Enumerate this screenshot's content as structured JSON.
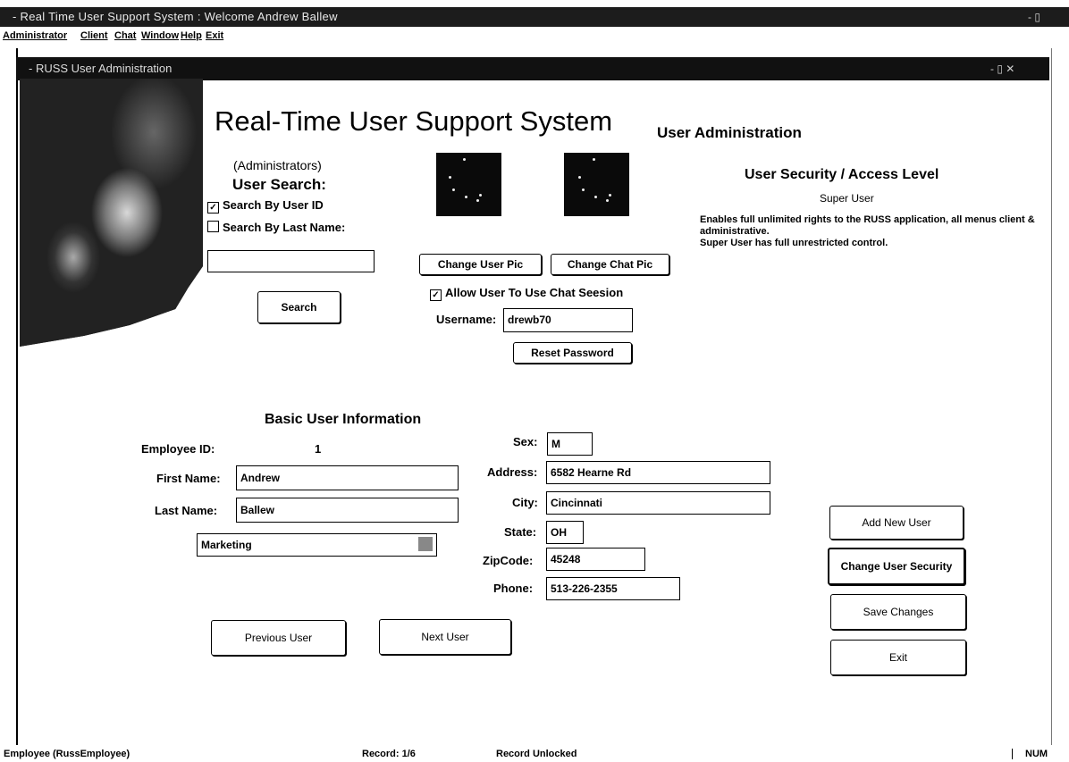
{
  "window": {
    "title": "- Real Time User Support System : Welcome Andrew Ballew",
    "controls": "- ▯"
  },
  "menu": [
    "Administrator",
    "Client",
    "Chat",
    "Window",
    "Help",
    "Exit"
  ],
  "child_window": {
    "title": "- RUSS User Administration",
    "controls": "- ▯ ✕"
  },
  "header": {
    "title": "Real-Time User Support System",
    "section": "User Administration",
    "subtitle": "(Administrators)"
  },
  "search": {
    "heading": "User Search:",
    "by_user_id": {
      "label": "Search By User ID",
      "checked": true
    },
    "by_last_name": {
      "label": "Search By Last Name:",
      "checked": false
    },
    "input_value": "",
    "button": "Search"
  },
  "pictures": {
    "change_user_pic": "Change User Pic",
    "change_chat_pic": "Change Chat Pic",
    "allow_chat": {
      "label": "Allow User To Use Chat Seesion",
      "checked": true
    },
    "username_label": "Username:",
    "username_value": "drewb70",
    "reset_password": "Reset Password"
  },
  "security": {
    "heading": "User Security / Access Level",
    "level": "Super User",
    "description": "Enables full unlimited rights to the RUSS application, all menus client & administrative.",
    "note": "Super User has full unrestricted control."
  },
  "basic_info": {
    "heading": "Basic User Information",
    "employee_id_label": "Employee ID:",
    "employee_id": "1",
    "first_name_label": "First Name:",
    "first_name": "Andrew",
    "last_name_label": "Last Name:",
    "last_name": "Ballew",
    "department": "Marketing",
    "sex_label": "Sex:",
    "sex": "M",
    "address_label": "Address:",
    "address": "6582 Hearne Rd",
    "city_label": "City:",
    "city": "Cincinnati",
    "state_label": "State:",
    "state": "OH",
    "zip_label": "ZipCode:",
    "zip": "45248",
    "phone_label": "Phone:",
    "phone": "513-226-2355"
  },
  "nav": {
    "previous": "Previous User",
    "next": "Next User"
  },
  "actions": {
    "add_new": "Add New User",
    "change_security": "Change User Security",
    "save": "Save Changes",
    "exit": "Exit"
  },
  "status": {
    "form": "Employee (RussEmployee)",
    "record": "Record: 1/6",
    "lock": "Record Unlocked",
    "num": "NUM"
  }
}
